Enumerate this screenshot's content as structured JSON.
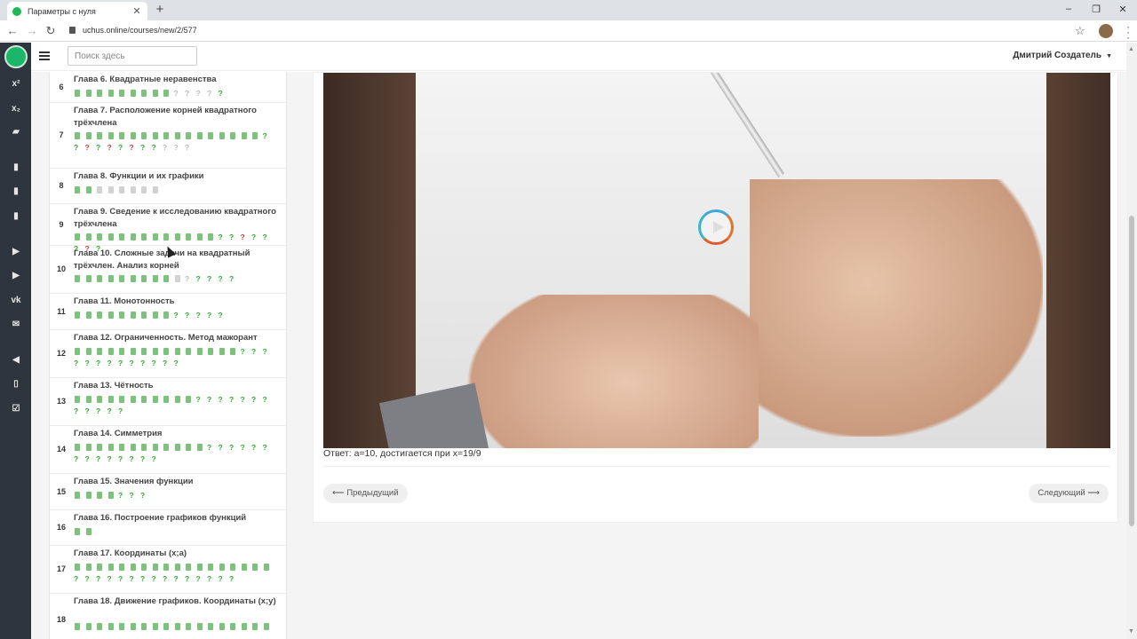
{
  "browser": {
    "tab_title": "Параметры с нуля",
    "url": "uchus.online/courses/new/2/577"
  },
  "header": {
    "search_placeholder": "Поиск здесь",
    "user_name": "Дмитрий Создатель"
  },
  "sidebar_icons": [
    "logo-icon",
    "superscript-icon",
    "subscript-icon",
    "folder-icon",
    "book-icon",
    "book-icon",
    "book-icon",
    "youtube-icon",
    "youtube-icon",
    "vk-icon",
    "mail-icon",
    "megaphone-icon",
    "document-icon",
    "checklist-icon"
  ],
  "chapters": [
    {
      "num": "6",
      "title": "Глава 6. Квадратные неравенства",
      "items": "dddddddddgqgqgqgqq"
    },
    {
      "num": "7",
      "title": "Глава 7. Расположение корней квадратного трёхчлена",
      "items": "dddddddddddddddddqqrqrqrqqgqgqgq"
    },
    {
      "num": "8",
      "title": "Глава 8. Функции и их графики",
      "items": "ddgdgdgdgdgdgd"
    },
    {
      "num": "9",
      "title": "Глава 9. Сведение к исследованию квадратного трёхчлена",
      "items": "dddddddddddddqqrqqqrq"
    },
    {
      "num": "10",
      "title": "Глава 10. Сложные задачи на квадратный трёхчлен. Анализ корней",
      "items": "dddddddddgdgqqqqqg"
    },
    {
      "num": "11",
      "title": "Глава 11. Монотонность",
      "items": "dddddddddqqqqq"
    },
    {
      "num": "12",
      "title": "Глава 12. Ограниченность. Метод мажорант",
      "items": "dddddddddddddddqqqqqqqqqqqqq"
    },
    {
      "num": "13",
      "title": "Глава 13. Чётность",
      "items": "dddddddddddqqqqqqqqqqqq"
    },
    {
      "num": "14",
      "title": "Глава 14. Симметрия",
      "items": "ddddddddddddqqqqqqqqqqqqqq"
    },
    {
      "num": "15",
      "title": "Глава 15. Значения функции",
      "items": "ddddqqq"
    },
    {
      "num": "16",
      "title": "Глава 16. Построение графиков функций",
      "items": "dd"
    },
    {
      "num": "17",
      "title": "Глава 17. Координаты (x;a)",
      "items": "ddddddddddddddddddqqqqqqqqqqqqqqq"
    },
    {
      "num": "18",
      "title": "Глава 18. Движение графиков. Координаты (x;y)",
      "items": "dddddddddddddddddd"
    }
  ],
  "main": {
    "answer": "Ответ: a=10, достигается при x=19/9",
    "prev_label": "⟵ Предыдущий",
    "next_label": "Следующий ⟶"
  }
}
